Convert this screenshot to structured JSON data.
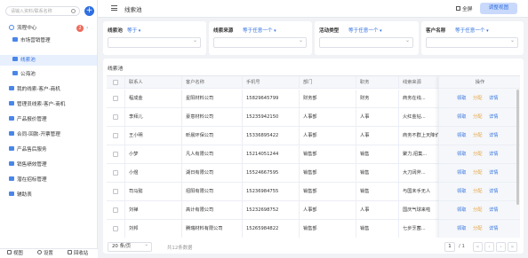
{
  "sidebar": {
    "search_placeholder": "请输入资料/联系名称",
    "add_label": "+",
    "items": [
      {
        "label": "流程中心",
        "badge": "2",
        "type": "bubble"
      },
      {
        "label": "市场营销管理",
        "type": "folder"
      },
      {
        "label": "线索池",
        "type": "folder",
        "active": true
      },
      {
        "label": "公海池",
        "type": "folder"
      },
      {
        "label": "我的线索-客户-商机",
        "type": "folder"
      },
      {
        "label": "管理员线索-客户-商机",
        "type": "folder"
      },
      {
        "label": "产品报价管理",
        "type": "folder"
      },
      {
        "label": "合同-回款-开票管理",
        "type": "folder"
      },
      {
        "label": "产品售后服务",
        "type": "folder"
      },
      {
        "label": "销售绩效管理",
        "type": "folder"
      },
      {
        "label": "潜在招标管理",
        "type": "folder"
      },
      {
        "label": "辅助表",
        "type": "folder"
      }
    ],
    "footer": {
      "view": "视图",
      "settings": "设置",
      "collapse": "回收站"
    }
  },
  "header": {
    "title": "线索池",
    "fullscreen": "全屏",
    "adjust": "调整视图"
  },
  "filters": [
    {
      "label": "线索池",
      "op": "等于"
    },
    {
      "label": "线索来源",
      "op": "等于任意一个"
    },
    {
      "label": "活动类型",
      "op": "等于任意一个"
    },
    {
      "label": "客户名称",
      "op": "等于任意一个"
    }
  ],
  "table": {
    "title": "线索池",
    "columns": [
      "联系人",
      "客户名称",
      "手机号",
      "部门",
      "职务",
      "线索来源"
    ],
    "ops_header": "操作",
    "rows": [
      {
        "contact": "程成金",
        "company": "星阳材料公司",
        "phone": "15829645799",
        "dept": "财务部",
        "role": "财务",
        "source": "商务在线..."
      },
      {
        "contact": "李拜儿",
        "company": "豪意材料公司",
        "phone": "15235942150",
        "dept": "人事部",
        "role": "人事",
        "source": "火红金钻..."
      },
      {
        "contact": "王小明",
        "company": "昕晨环保公司",
        "phone": "15336895422",
        "dept": "人事部",
        "role": "人事",
        "source": "商务不群上天降价"
      },
      {
        "contact": "小梦",
        "company": "凡人有限公司",
        "phone": "15214051244",
        "dept": "销售部",
        "role": "销售",
        "source": "聚力,招集..."
      },
      {
        "contact": "小煜",
        "company": "湖日有限公司",
        "phone": "15524667595",
        "dept": "销售部",
        "role": "销售",
        "source": "大刀阔斧..."
      },
      {
        "contact": "司马懿",
        "company": "招阳有限公司",
        "phone": "15236984755",
        "dept": "销售部",
        "role": "销售",
        "source": "与国未手无人"
      },
      {
        "contact": "刘禅",
        "company": "高计有限公司",
        "phone": "15232698752",
        "dept": "人事部",
        "role": "人事",
        "source": "国庆气球来啦"
      },
      {
        "contact": "刘邦",
        "company": "腾瑞材料有限公司",
        "phone": "15265984822",
        "dept": "销售部",
        "role": "销售",
        "source": "七步烹菌..."
      }
    ],
    "op_labels": {
      "claim": "领取",
      "assign": "分配",
      "detail": "详情"
    }
  },
  "pagination": {
    "page_size": "20 条/页",
    "total": "共12条数据",
    "current": "1",
    "of": "/ 1",
    "first": "«",
    "prev": "‹",
    "next": "›",
    "last": "»"
  },
  "colors": {
    "accent": "#2f6fe0",
    "assign": "#e6a23c",
    "badge": "#ee6b5b"
  }
}
